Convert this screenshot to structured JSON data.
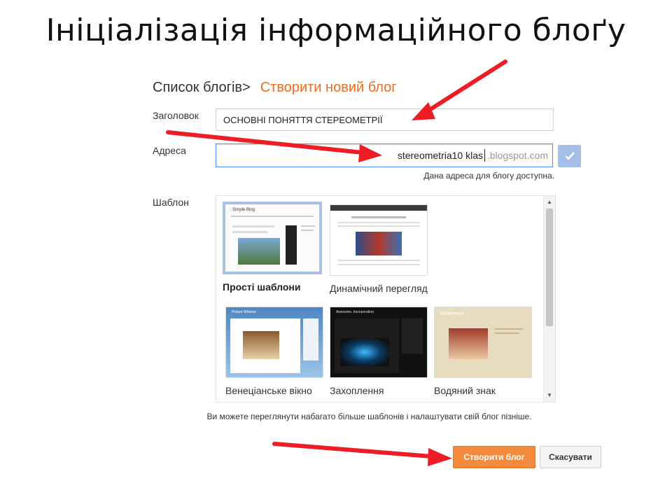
{
  "slide": {
    "title": "Ініціалізація інформаційного блоґу"
  },
  "breadcrumb": {
    "parent": "Список блогів>",
    "current": "Створити новий блог"
  },
  "form": {
    "title_label": "Заголовок",
    "title_value": "ОСНОВНІ ПОНЯТТЯ СТЕРЕОМЕТРІЇ",
    "address_label": "Адреса",
    "address_value": "stereometria10 klas",
    "address_suffix": ".blogspot.com",
    "availability": "Дана адреса для блогу доступна.",
    "template_label": "Шаблон"
  },
  "templates": [
    {
      "name": "Прості шаблони",
      "selected": true,
      "thumb_title": "Simple Blog"
    },
    {
      "name": "Динамічний перегляд",
      "selected": false,
      "thumb_title": ""
    },
    {
      "name": "Венеціанське вікно",
      "selected": false,
      "thumb_title": "Picture Window"
    },
    {
      "name": "Захоплення",
      "selected": false,
      "thumb_title": "Awesome, Incorporation"
    },
    {
      "name": "Водяний знак",
      "selected": false,
      "thumb_title": "Watermark"
    }
  ],
  "hint": "Ви можете переглянути набагато більше шаблонів і налаштувати свій блог пізніше.",
  "buttons": {
    "create": "Створити блог",
    "cancel": "Скасувати"
  },
  "colors": {
    "accent_orange": "#f48a3b",
    "link_orange": "#f26a1b",
    "arrow_red": "#ee1c24",
    "check_blue": "#a6bfe9"
  }
}
